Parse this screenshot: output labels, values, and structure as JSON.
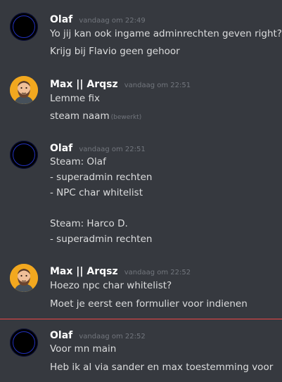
{
  "messages": [
    {
      "author": "Olaf",
      "timestamp": "vandaag om 22:49",
      "avatar": "dark-circle-avatar",
      "lines": [
        "Yo jij kan ook ingame adminrechten geven right?",
        "Krijg bij Flavio geen gehoor"
      ]
    },
    {
      "author": "Max || Arqsz",
      "timestamp": "vandaag om 22:51",
      "avatar": "bearded-man-avatar",
      "lines": [
        "Lemme fix",
        "steam naam"
      ],
      "edited_label": "(bewerkt)"
    },
    {
      "author": "Olaf",
      "timestamp": "vandaag om 22:51",
      "avatar": "dark-circle-avatar",
      "lines": [
        "Steam: Olaf",
        "- superadmin rechten",
        "- NPC char whitelist",
        "",
        "Steam: Harco D.",
        "- superadmin rechten"
      ]
    },
    {
      "author": "Max || Arqsz",
      "timestamp": "vandaag om 22:52",
      "avatar": "bearded-man-avatar",
      "lines": [
        "Hoezo npc char whitelist?",
        "Moet je eerst een formulier voor indienen"
      ]
    },
    {
      "author": "Olaf",
      "timestamp": "vandaag om 22:52",
      "avatar": "dark-circle-avatar",
      "lines": [
        "Voor mn main",
        "Heb ik al via sander en max toestemming voor"
      ]
    }
  ],
  "colors": {
    "background": "#36393f",
    "username": "#ffffff",
    "timestamp": "#72767d",
    "text": "#dcddde",
    "new_messages_divider": "#f04747"
  }
}
